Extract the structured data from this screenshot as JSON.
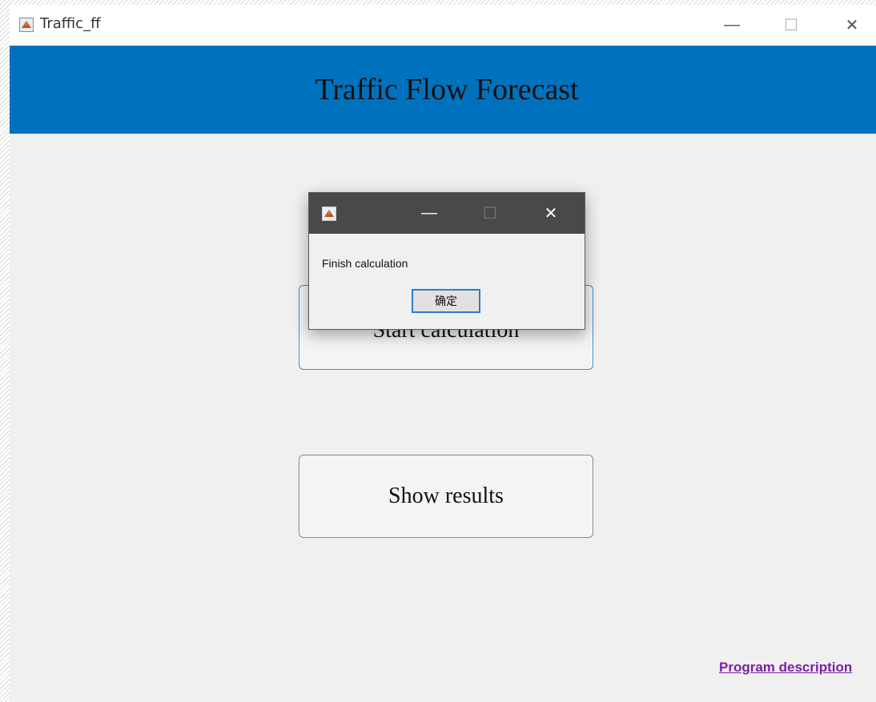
{
  "window": {
    "title": "Traffic_ff",
    "controls": {
      "minimize": "—",
      "maximize": "☐",
      "close": "✕"
    }
  },
  "header": {
    "title": "Traffic Flow Forecast"
  },
  "main": {
    "start_button_label": "Start calculation",
    "show_results_label": "Show results",
    "program_description_link": "Program description"
  },
  "dialog": {
    "title": "",
    "message": "Finish calculation",
    "ok_label": "确定",
    "controls": {
      "minimize": "—",
      "maximize": "☐",
      "close": "✕"
    }
  },
  "colors": {
    "header_band": "#0072bd",
    "dialog_titlebar": "#4a4949",
    "link": "#7b1fa2",
    "focus_border": "#2f7ad0"
  }
}
